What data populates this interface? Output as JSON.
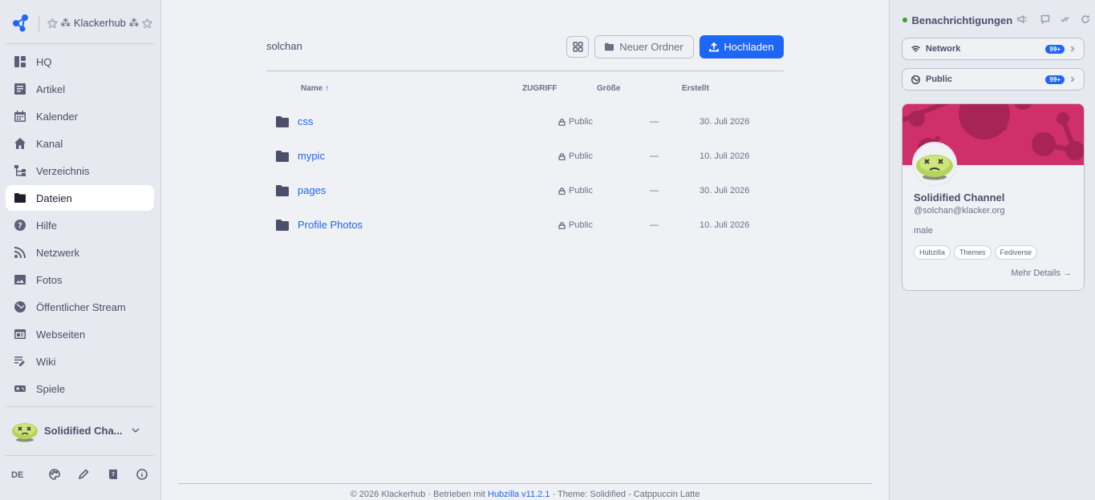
{
  "brand": {
    "name": "⚝ ⁂ Klackerhub ⁂ ⚝"
  },
  "nav": {
    "items": [
      {
        "label": "HQ"
      },
      {
        "label": "Artikel"
      },
      {
        "label": "Kalender"
      },
      {
        "label": "Kanal"
      },
      {
        "label": "Verzeichnis"
      },
      {
        "label": "Dateien"
      },
      {
        "label": "Hilfe"
      },
      {
        "label": "Netzwerk"
      },
      {
        "label": "Fotos"
      },
      {
        "label": "Öffentlicher Stream"
      },
      {
        "label": "Webseiten"
      },
      {
        "label": "Wiki"
      },
      {
        "label": "Spiele"
      }
    ]
  },
  "profile": {
    "name": "Solidified Cha..."
  },
  "bottom": {
    "lang": "DE"
  },
  "files": {
    "folder": "solchan",
    "new_folder_label": "Neuer Ordner",
    "upload_label": "Hochladen",
    "columns": {
      "name": "Name",
      "sort_arrow": "↑",
      "access": "ZUGRIFF",
      "size": "Größe",
      "created": "Erstellt"
    },
    "rows": [
      {
        "name": "css",
        "access": "Public",
        "size": "—",
        "created": "30. Juli 2026"
      },
      {
        "name": "mypic",
        "access": "Public",
        "size": "—",
        "created": "10. Juli 2026"
      },
      {
        "name": "pages",
        "access": "Public",
        "size": "—",
        "created": "30. Juli 2026"
      },
      {
        "name": "Profile Photos",
        "access": "Public",
        "size": "—",
        "created": "10. Juli 2026"
      }
    ]
  },
  "footer": {
    "prefix": "© 2026 Klackerhub · Betrieben mit ",
    "link": "Hubzilla v11.2.1",
    "suffix": " · Theme: Solidified - Catppuccin Latte"
  },
  "notifications": {
    "title": "Benachrichtigungen",
    "network": {
      "label": "Network",
      "badge": "99+"
    },
    "public": {
      "label": "Public",
      "badge": "99+"
    }
  },
  "card": {
    "name": "Solidified Channel",
    "handle": "@solchan@klacker.org",
    "gender": "male",
    "tags": [
      "Hubzilla",
      "Themes",
      "Fediverse"
    ],
    "more": "Mehr Details →"
  },
  "colors": {
    "accent": "#1e66f5",
    "cover": "#d0306a",
    "online": "#40a02b"
  }
}
